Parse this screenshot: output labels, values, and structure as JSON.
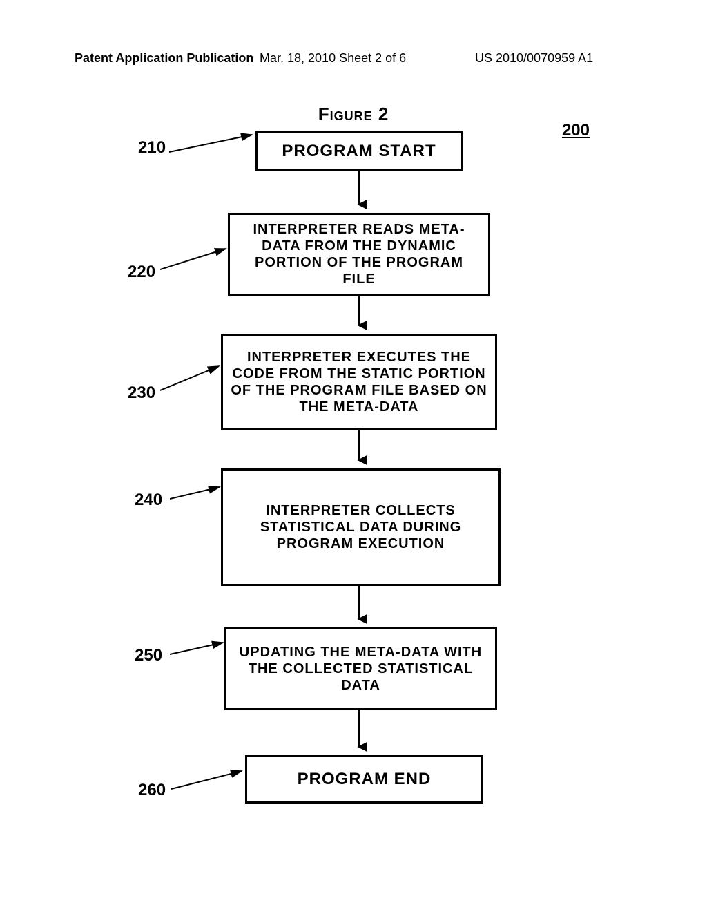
{
  "header": {
    "left": "Patent Application Publication",
    "center": "Mar. 18, 2010  Sheet 2 of 6",
    "right": "US 2010/0070959 A1"
  },
  "figure": {
    "title": "Figure 2",
    "overall_ref": "200"
  },
  "steps": [
    {
      "ref": "210",
      "text": "PROGRAM START"
    },
    {
      "ref": "220",
      "text": "INTERPRETER READS META-DATA FROM THE DYNAMIC PORTION OF THE PROGRAM FILE"
    },
    {
      "ref": "230",
      "text": "INTERPRETER EXECUTES THE CODE FROM THE STATIC PORTION OF THE PROGRAM FILE BASED ON THE META-DATA"
    },
    {
      "ref": "240",
      "text": "INTERPRETER COLLECTS STATISTICAL DATA DURING PROGRAM EXECUTION"
    },
    {
      "ref": "250",
      "text": "UPDATING THE META-DATA WITH THE COLLECTED STATISTICAL DATA"
    },
    {
      "ref": "260",
      "text": "PROGRAM END"
    }
  ]
}
